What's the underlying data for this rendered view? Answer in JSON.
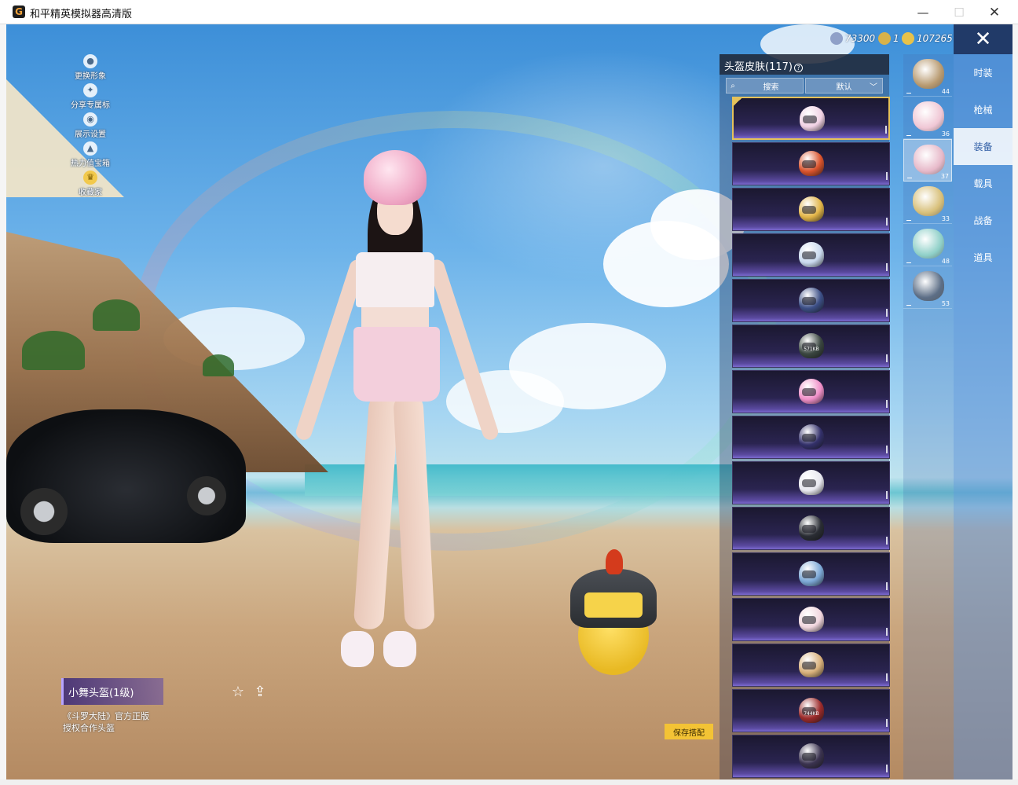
{
  "window": {
    "title": "和平精英模拟器高清版",
    "icon_glyph": "G",
    "minimize_icon": "—",
    "maximize_icon": "☐",
    "close_icon": "✕"
  },
  "currency": [
    {
      "icon": "gem-icon",
      "value": "73300",
      "color": "#8fa0c8"
    },
    {
      "icon": "coin-icon",
      "value": "1",
      "color": "#d7b24b"
    },
    {
      "icon": "gold-icon",
      "value": "107265",
      "color": "#e8c24a"
    }
  ],
  "close_panel_icon": "✕",
  "side_menu": [
    {
      "label": "更换形象",
      "icon": "person-icon"
    },
    {
      "label": "分享专属标",
      "icon": "share-badge-icon"
    },
    {
      "label": "展示设置",
      "icon": "eye-icon"
    },
    {
      "label": "热力值宝箱",
      "icon": "fire-icon"
    },
    {
      "label": "收藏家",
      "icon": "trophy-icon"
    }
  ],
  "list_panel": {
    "header": "头盔皮肤(117)",
    "help_icon": "?",
    "search_placeholder": "搜索",
    "sort_label": "默认",
    "items": [
      {
        "color": "#f1d2e4",
        "selected": true
      },
      {
        "color": "#d9532c"
      },
      {
        "color": "#e2b548"
      },
      {
        "color": "#c9d9ee"
      },
      {
        "color": "#3c4f86"
      },
      {
        "color": "#3a4640",
        "tag": "571KB"
      },
      {
        "color": "#f08fc8"
      },
      {
        "color": "#33306a"
      },
      {
        "color": "#e8e8ef"
      },
      {
        "color": "#2a2d34"
      },
      {
        "color": "#7ca8d6"
      },
      {
        "color": "#f1d6de"
      },
      {
        "color": "#d8b07a"
      },
      {
        "color": "#9b2b2b",
        "tag": "744KB"
      },
      {
        "color": "#3b3350"
      }
    ]
  },
  "equipped_slots": [
    {
      "icon": "helmet-slot-icon",
      "count": "44",
      "color": "#b89a70"
    },
    {
      "icon": "hat-slot-icon",
      "count": "36",
      "color": "#f0c7d5"
    },
    {
      "icon": "helmet-pink-slot-icon",
      "count": "37",
      "color": "#e7b9c9",
      "active": true
    },
    {
      "icon": "backpack-slot-icon",
      "count": "33",
      "color": "#d8c07a"
    },
    {
      "icon": "pet-slot-icon",
      "count": "48",
      "color": "#8fd0c8"
    },
    {
      "icon": "pendant-slot-icon",
      "count": "53",
      "color": "#5c6e86"
    }
  ],
  "tabs": [
    {
      "label": "时装"
    },
    {
      "label": "枪械"
    },
    {
      "label": "装备",
      "active": true
    },
    {
      "label": "载具"
    },
    {
      "label": "战备"
    },
    {
      "label": "道具"
    }
  ],
  "selected_item": {
    "name": "小舞头盔(1级)",
    "desc_line1": "《斗罗大陆》官方正版",
    "desc_line2": "授权合作头盔",
    "fav_icon": "☆",
    "share_icon": "⇪"
  },
  "save_button": "保存搭配"
}
